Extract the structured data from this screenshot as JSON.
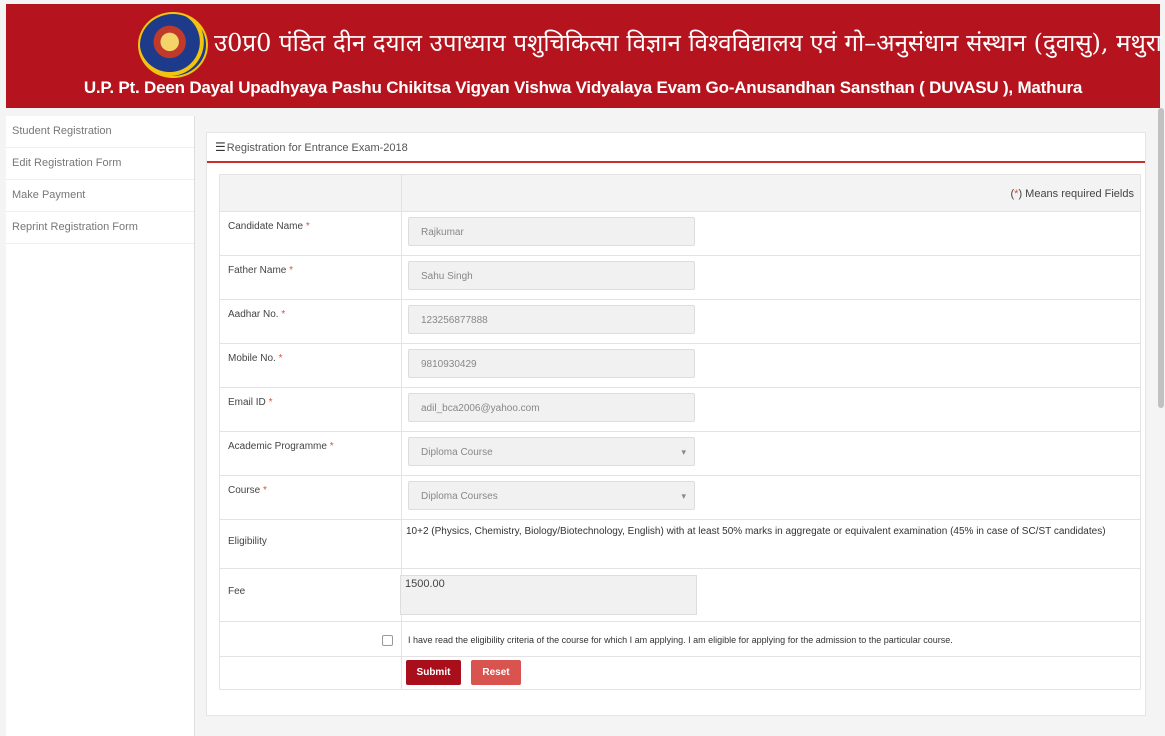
{
  "header": {
    "hindi_title": "उ0प्र0 पंडित दीन दयाल उपाध्याय पशुचिकित्सा विज्ञान विश्वविद्यालय एवं गो–अनुसंधान संस्थान (दुवासु), मथुरा",
    "english_title": "U.P. Pt. Deen Dayal Upadhyaya Pashu Chikitsa Vigyan Vishwa Vidyalaya Evam Go-Anusandhan Sansthan ( DUVASU ), Mathura",
    "colors": {
      "brand": "#b5141e",
      "accent": "#c9302c"
    }
  },
  "sidebar": {
    "items": [
      {
        "label": "Student Registration"
      },
      {
        "label": "Edit Registration Form"
      },
      {
        "label": "Make Payment"
      },
      {
        "label": "Reprint Registration Form"
      }
    ]
  },
  "panel": {
    "title": "Registration for Entrance Exam-2018",
    "required_note_open": "(",
    "required_star": "*",
    "required_note_close": ") Means required Fields"
  },
  "form": {
    "required_mark": "*",
    "fields": [
      {
        "label": "Candidate Name",
        "value": "Rajkumar"
      },
      {
        "label": "Father Name",
        "value": "Sahu Singh"
      },
      {
        "label": "Aadhar No.",
        "value": "123256877888"
      },
      {
        "label": "Mobile No.",
        "value": "9810930429"
      },
      {
        "label": "Email ID",
        "value": "adil_bca2006@yahoo.com"
      }
    ],
    "selects": [
      {
        "label": "Academic Programme",
        "value": "Diploma Course"
      },
      {
        "label": "Course",
        "value": "Diploma Courses"
      }
    ],
    "eligibility": {
      "label": "Eligibility",
      "text": "10+2 (Physics, Chemistry, Biology/Biotechnology, English) with at least 50% marks in aggregate or equivalent examination (45% in case of SC/ST candidates)"
    },
    "fee": {
      "label": "Fee",
      "value": "1500.00"
    },
    "declaration": "I have read the eligibility criteria of the course for which I am applying. I am eligible for applying for the admission to the particular course.",
    "submit_label": "Submit",
    "reset_label": "Reset"
  }
}
